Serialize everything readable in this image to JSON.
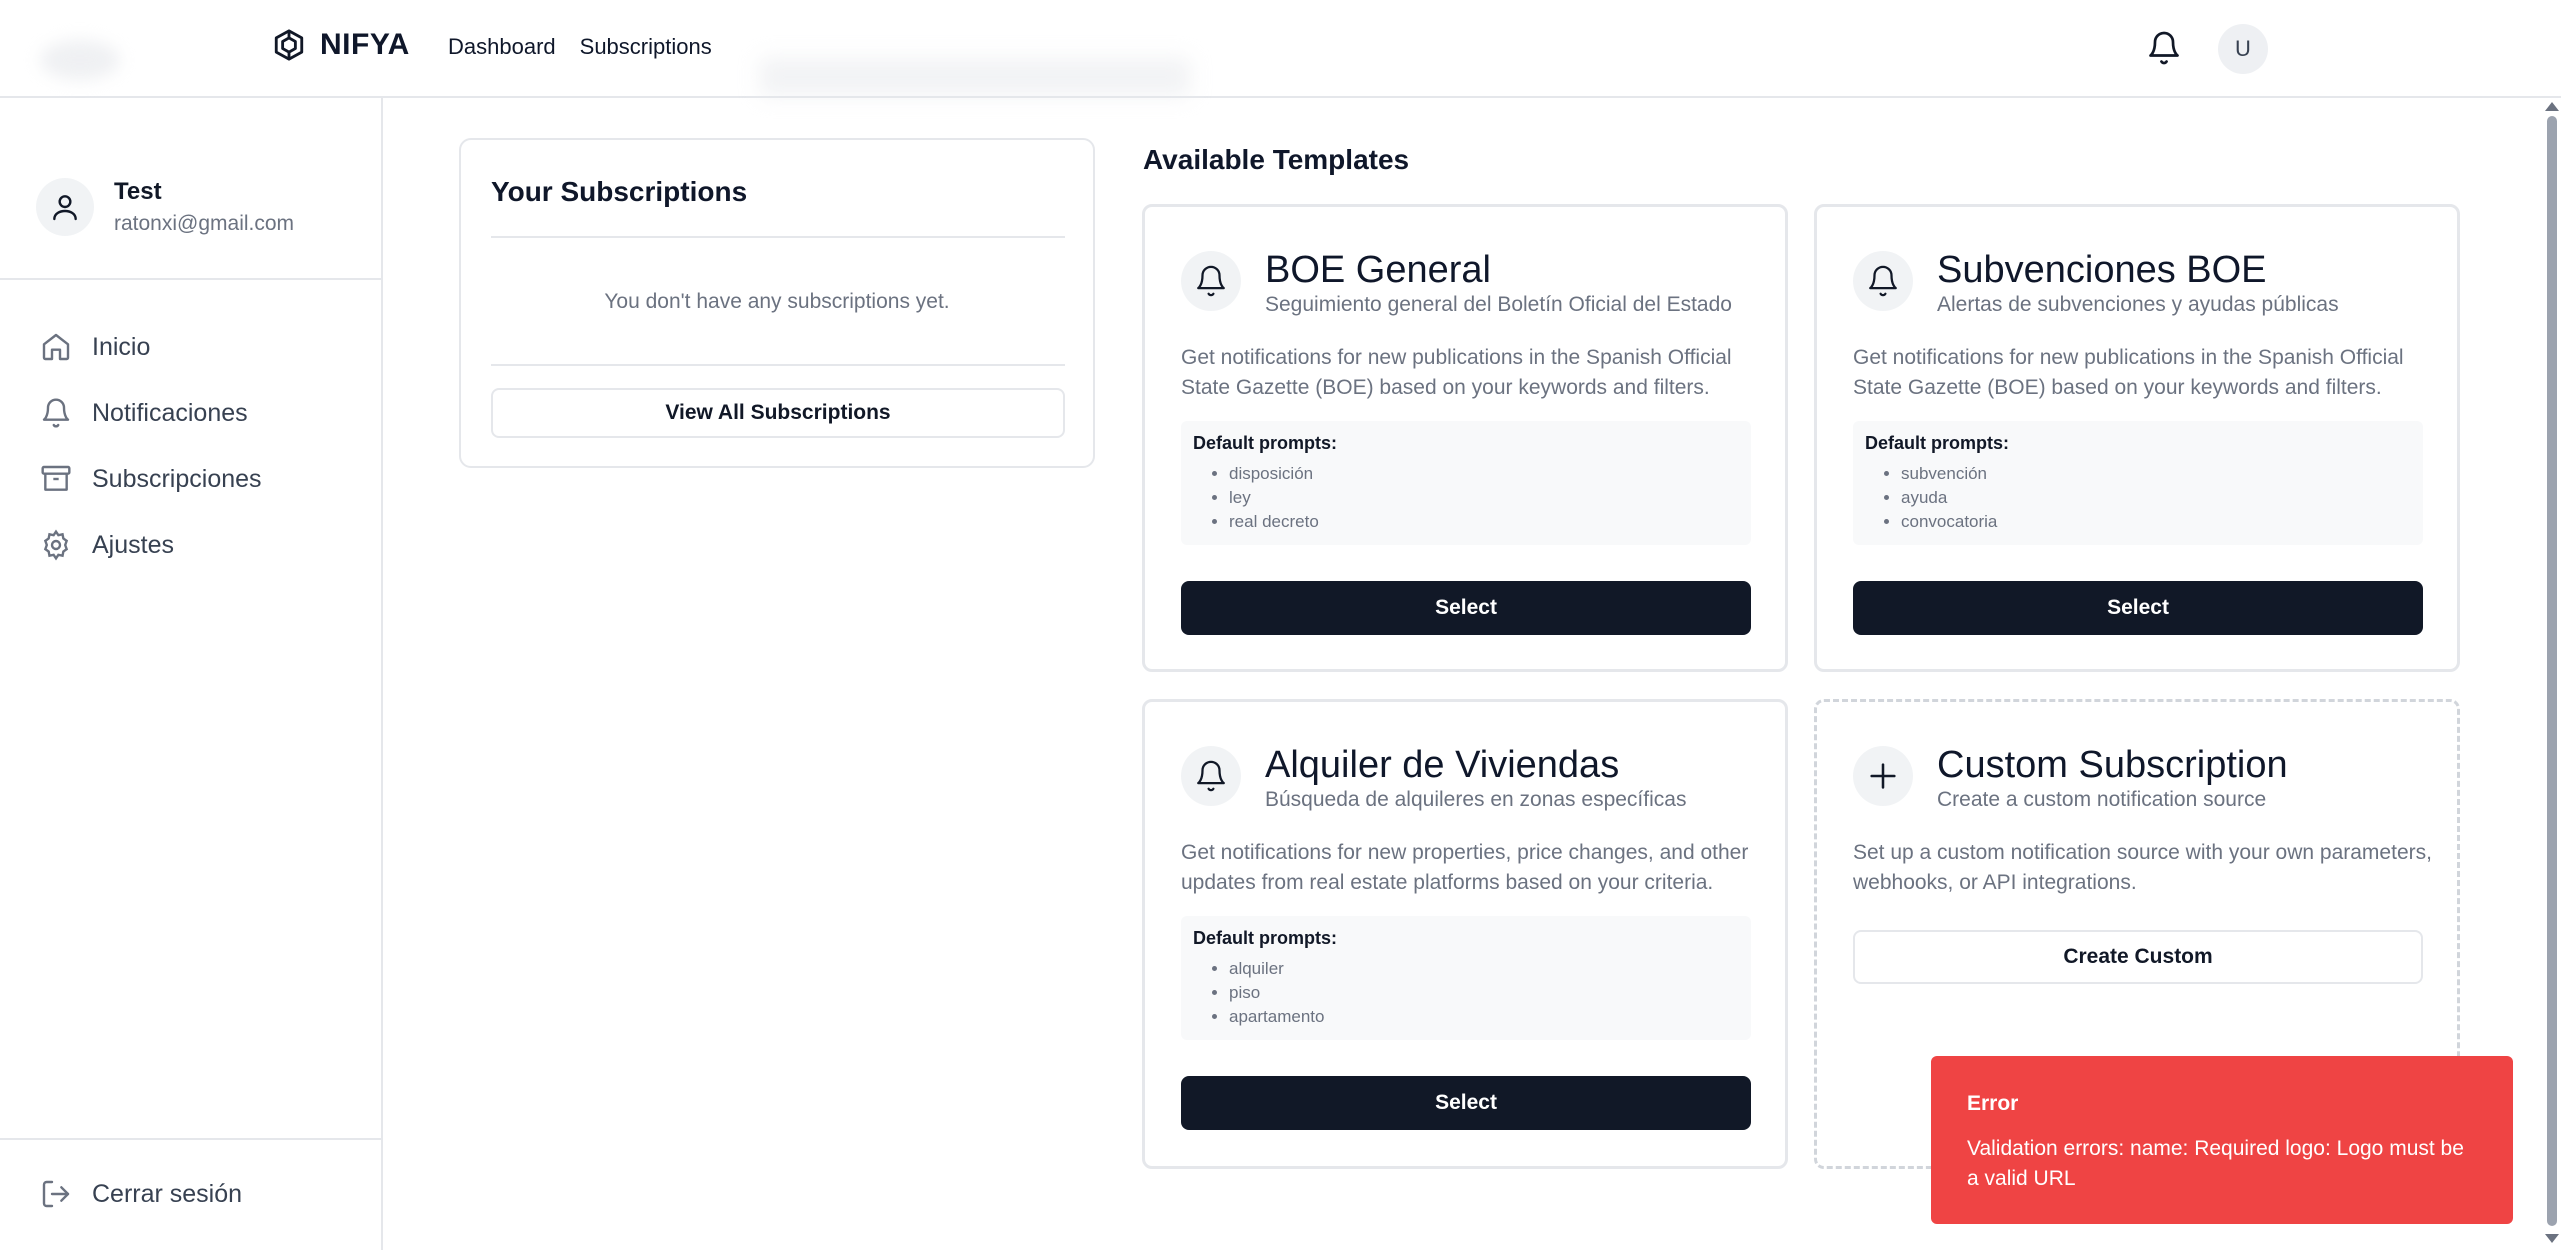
{
  "header": {
    "brand": "NIFYA",
    "nav": [
      "Dashboard",
      "Subscriptions"
    ],
    "avatar_initial": "U"
  },
  "sidebar": {
    "user_name": "Test",
    "user_email": "ratonxi@gmail.com",
    "items": [
      {
        "label": "Inicio",
        "icon": "home-icon"
      },
      {
        "label": "Notificaciones",
        "icon": "bell-icon"
      },
      {
        "label": "Subscripciones",
        "icon": "archive-icon"
      },
      {
        "label": "Ajustes",
        "icon": "gear-icon"
      }
    ],
    "logout_label": "Cerrar sesión"
  },
  "subscriptions": {
    "title": "Your Subscriptions",
    "empty_text": "You don't have any subscriptions yet.",
    "view_all_label": "View All Subscriptions"
  },
  "templates": {
    "heading": "Available Templates",
    "prompts_label": "Default prompts:",
    "select_label": "Select",
    "cards": [
      {
        "title": "BOE General",
        "subtitle": "Seguimiento general del Boletín Oficial del Estado",
        "description": "Get notifications for new publications in the Spanish Official State Gazette (BOE) based on your keywords and filters.",
        "prompts": [
          "disposición",
          "ley",
          "real decreto"
        ]
      },
      {
        "title": "Subvenciones BOE",
        "subtitle": "Alertas de subvenciones y ayudas públicas",
        "description": "Get notifications for new publications in the Spanish Official State Gazette (BOE) based on your keywords and filters.",
        "prompts": [
          "subvención",
          "ayuda",
          "convocatoria"
        ]
      },
      {
        "title": "Alquiler de Viviendas",
        "subtitle": "Búsqueda de alquileres en zonas específicas",
        "description": "Get notifications for new properties, price changes, and other updates from real estate platforms based on your criteria.",
        "prompts": [
          "alquiler",
          "piso",
          "apartamento"
        ]
      }
    ],
    "custom": {
      "title": "Custom Subscription",
      "subtitle": "Create a custom notification source",
      "description": "Set up a custom notification source with your own parameters, webhooks, or API integrations.",
      "button_label": "Create Custom"
    }
  },
  "toast": {
    "title": "Error",
    "message": "Validation errors: name: Required logo: Logo must be a valid URL",
    "color": "#ef4444"
  }
}
